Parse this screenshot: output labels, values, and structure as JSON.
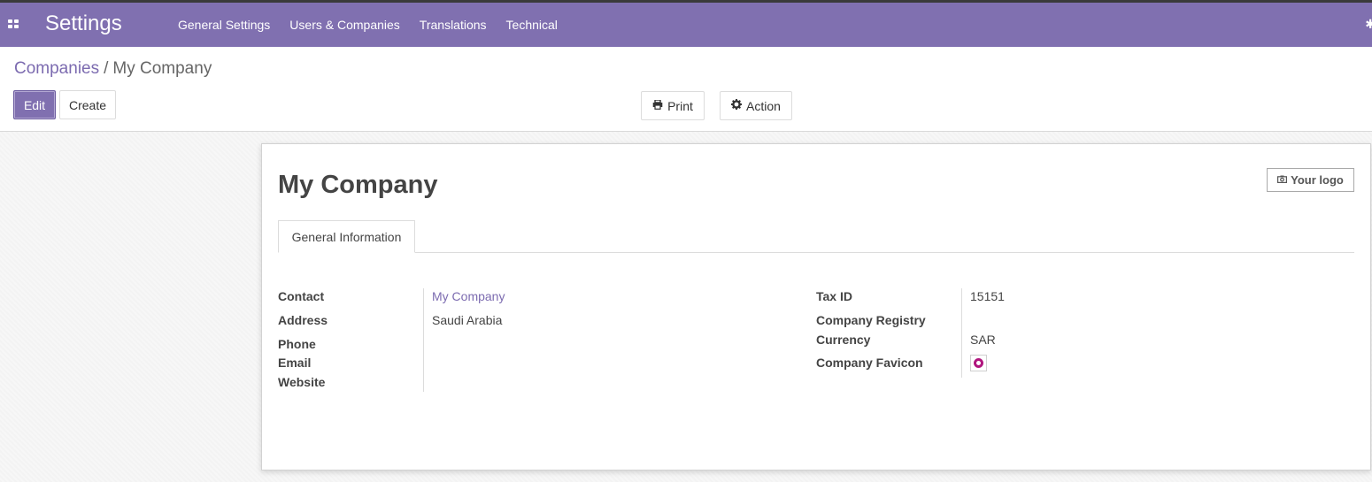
{
  "navbar": {
    "brand": "Settings",
    "menu": [
      "General Settings",
      "Users & Companies",
      "Translations",
      "Technical"
    ],
    "right_glyph": "✱",
    "color": "#8070b0"
  },
  "breadcrumb": {
    "parent": "Companies",
    "separator": "/",
    "current": "My Company"
  },
  "buttons": {
    "edit": "Edit",
    "create": "Create",
    "print": "Print",
    "action": "Action"
  },
  "form": {
    "name": "My Company",
    "logo_placeholder": "Your logo",
    "tab": "General Information",
    "left": {
      "contact_label": "Contact",
      "contact_value": "My Company",
      "address_label": "Address",
      "address_value": "Saudi Arabia",
      "phone_label": "Phone",
      "email_label": "Email",
      "website_label": "Website"
    },
    "right": {
      "taxid_label": "Tax ID",
      "taxid_value": "15151",
      "registry_label": "Company Registry",
      "currency_label": "Currency",
      "currency_value": "SAR",
      "favicon_label": "Company Favicon"
    }
  },
  "icons": {
    "apps": "apps-icon",
    "print": "print-icon",
    "action": "gear-icon",
    "logo": "camera-icon"
  }
}
